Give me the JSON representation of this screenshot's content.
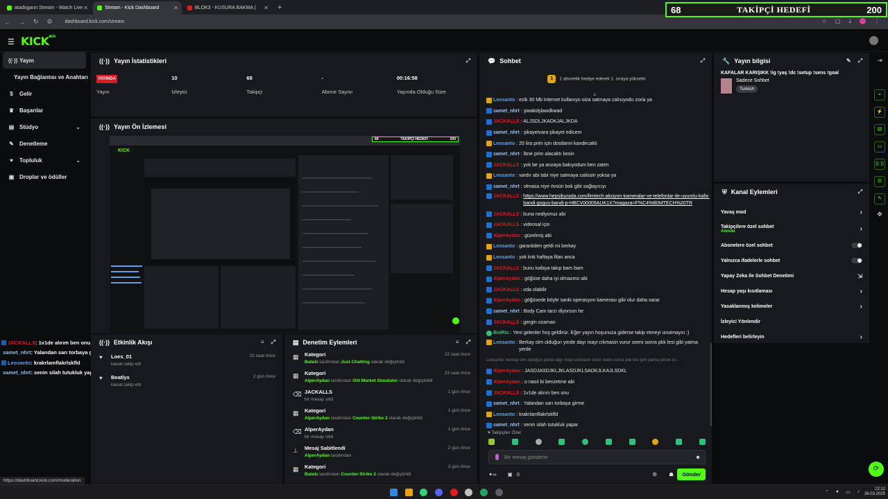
{
  "browser": {
    "tabs": [
      {
        "label": "atadogann Stream - Watch Live",
        "favicon_color": "#53fc18"
      },
      {
        "label": "Stream - Kick Dashboard",
        "favicon_color": "#53fc18"
      },
      {
        "label": "BLOK3 - KUSURA BAKMA (",
        "favicon_color": "#e01b24"
      }
    ],
    "new_tab": "+",
    "url": "dashboard.kick.com/stream",
    "status_url": "https://dashboard.kick.com/moderation"
  },
  "goal": {
    "current": "68",
    "label": "TAKİPÇİ HEDEFİ",
    "target": "200",
    "progress": 0.34
  },
  "app": {
    "logo": "KICK",
    "beta": "BETA"
  },
  "sidebar": {
    "items": [
      {
        "label": "Yayın",
        "icon": "broadcast-icon"
      },
      {
        "label": "Yayın Bağlantısı ve Anahtarı"
      },
      {
        "label": "Gelir",
        "icon": "dollar-icon"
      },
      {
        "label": "Başarılar",
        "icon": "trophy-icon"
      },
      {
        "label": "Stüdyo",
        "icon": "studio-icon"
      },
      {
        "label": "Denetleme",
        "icon": "wrench-icon"
      },
      {
        "label": "Topluluk",
        "icon": "community-icon"
      },
      {
        "label": "Droplar ve ödüller",
        "icon": "gift-icon"
      }
    ]
  },
  "left_overlay_chat": [
    {
      "user": "JACKALLS",
      "color": "#e01b24",
      "text": ": 1v1de alırım ben onu"
    },
    {
      "user": "samet_nhrt",
      "color": "#99c1f1",
      "text": ": Yalandan sarı torbaya girme"
    },
    {
      "user": "Leosanto",
      "color": "#62a0ea",
      "text": ": krakrlamflakrlskfld"
    },
    {
      "user": "samet_nhrt",
      "color": "#99c1f1",
      "text": ": senin silah tutukluk yapar"
    }
  ],
  "stats_panel": {
    "title": "Yayın İstatistikleri",
    "live_badge": "YAYINDA",
    "items": [
      {
        "value": "",
        "label": "Yayın"
      },
      {
        "value": "10",
        "label": "İzleyici"
      },
      {
        "value": "68",
        "label": "Takipçi"
      },
      {
        "value": "-",
        "label": "Abone Sayısı"
      },
      {
        "value": "00:16:58",
        "label": "Yayında Olduğu Süre"
      }
    ]
  },
  "preview_panel": {
    "title": "Yayın Ön İzlemesi",
    "mini_goal_current": "68",
    "mini_goal_label": "TAKİPÇİ HEDEFİ",
    "mini_goal_target": "200",
    "mini_logo": "KICK"
  },
  "activity_panel": {
    "title": "Etkinlik Akışı",
    "items": [
      {
        "name": "Loes_01",
        "sub": "kanalı takip etti",
        "time": "22 saat önce"
      },
      {
        "name": "Beatlyx",
        "sub": "kanalı takip etti",
        "time": "2 gün önce"
      }
    ]
  },
  "moderation_panel": {
    "title": "Denetim Eylemleri",
    "items": [
      {
        "title": "Kategori",
        "actor": "Batuiz",
        "mid": " tarafından ",
        "target": "Just Chatting",
        "end": " olarak değiştirildi",
        "time": "22 saat önce",
        "icon": "category-icon"
      },
      {
        "title": "Kategori",
        "actor": "AlperAydan",
        "mid": " tarafından ",
        "target": "Old Market Simulator",
        "end": " olarak değiştirildi",
        "time": "23 saat önce",
        "icon": "category-icon"
      },
      {
        "title": "JACKALLS",
        "actor": "",
        "mid": "bir mesajı sildi",
        "target": "",
        "end": "",
        "time": "1 gün önce",
        "icon": "trash-icon"
      },
      {
        "title": "Kategori",
        "actor": "AlperAydan",
        "mid": " tarafından ",
        "target": "Counter-Strike 2",
        "end": " olarak değiştirildi",
        "time": "1 gün önce",
        "icon": "category-icon"
      },
      {
        "title": "AlperAydan",
        "actor": "",
        "mid": "bir mesajı sildi",
        "target": "",
        "end": "",
        "time": "1 gün önce",
        "icon": "trash-icon"
      },
      {
        "title": "Mesaj Sabitlendi",
        "actor": "AlperAydan",
        "mid": " tarafından",
        "target": "",
        "end": "",
        "time": "2 gün önce",
        "icon": "pin-icon"
      },
      {
        "title": "Kategori",
        "actor": "Batuiz",
        "mid": " tarafından ",
        "target": "Counter-Strike 2",
        "end": " olarak değiştirildi",
        "time": "2 gün önce",
        "icon": "category-icon"
      }
    ]
  },
  "chat_panel": {
    "title": "Sohbet",
    "sub_gift": "1 abonelik hediye ederek 1. sıraya yükselin",
    "sub_gift_rank": "1",
    "messages": [
      {
        "user": "Leosanto",
        "color": "#62a0ea",
        "badge": "y",
        "text": "ezik 30 Mb internet kullanıyo oiza satmaya calısıyodu zoria ya"
      },
      {
        "user": "samet_nhrt",
        "color": "#99c1f1",
        "badge": "",
        "text": "şiwakdşlawdkwad"
      },
      {
        "user": "JACKALLS",
        "color": "#e01b24",
        "badge": "",
        "text": "ALJSDLJKADKJALJKDA"
      },
      {
        "user": "samet_nhrt",
        "color": "#99c1f1",
        "badge": "",
        "text": "şikayetvara şikayet edicem"
      },
      {
        "user": "Leosanto",
        "color": "#62a0ea",
        "badge": "y",
        "text": "20 lira prim için dostlarini kandircakti"
      },
      {
        "user": "samet_nhrt",
        "color": "#99c1f1",
        "badge": "",
        "text": "lbne prim alacaktı kesin"
      },
      {
        "user": "JACKALLS",
        "color": "#e01b24",
        "badge": "",
        "text": "yok be ya anzaya bakıyodum ben zaten"
      },
      {
        "user": "Leosanto",
        "color": "#62a0ea",
        "badge": "y",
        "text": "vardır abi tabi niye satmaya calissin yoksa ya"
      },
      {
        "user": "samet_nhrt",
        "color": "#99c1f1",
        "badge": "",
        "text": "olmasa niye övsün bok gibi sağlayıcıyı"
      },
      {
        "user": "JACKALLS",
        "color": "#e01b24",
        "badge": "",
        "link": "https://www.hepsiburada.com/fimtech-aksiyon-kameralar-ve-telefonlar-ile-uyumlu-kafa-bandi-gogus-bandi-p-HBCV00009AUK1X?magaza=F%C4%B0MTECH%20TR"
      },
      {
        "user": "JACKALLS",
        "color": "#e01b24",
        "badge": "",
        "text": "buna nediyonuz abi"
      },
      {
        "user": "JACKALLS",
        "color": "#e01b24",
        "badge": "",
        "text": "videosal için"
      },
      {
        "user": "AlperAydan",
        "color": "#e01b24",
        "badge": "",
        "text": "güzelmiş abi"
      },
      {
        "user": "Leosanto",
        "color": "#62a0ea",
        "badge": "y",
        "text": "garantiden geldi mi berkay"
      },
      {
        "user": "Leosanto",
        "color": "#62a0ea",
        "badge": "y",
        "text": "yok knk haftaya filan anca"
      },
      {
        "user": "JACKALLS",
        "color": "#e01b24",
        "badge": "",
        "text": "bunu kafaya takıp bam bam"
      },
      {
        "user": "AlperAydan",
        "color": "#e01b24",
        "badge": "",
        "text": "göğüse daha iyi olmazmo abi"
      },
      {
        "user": "JACKALLS",
        "color": "#e01b24",
        "badge": "",
        "text": "oda olabilir"
      },
      {
        "user": "AlperAydan",
        "color": "#e01b24",
        "badge": "",
        "text": "göğüsede böyle sanki operasyon kamerası gibi olur daha sarar"
      },
      {
        "user": "samet_nhrt",
        "color": "#99c1f1",
        "badge": "",
        "text": "Body Cam tarzı diyorsun he"
      },
      {
        "user": "JACKALLS",
        "color": "#e01b24",
        "badge": "",
        "text": "gergin ozaman"
      },
      {
        "user": "BotRix",
        "color": "#2ec27e",
        "badge": "gr",
        "text": "Yeni gelenler hoş geldiniz. Eğer yayın hoşunuza giderse takip etmeyi unutmayın :)"
      },
      {
        "user": "Leosanto",
        "color": "#62a0ea",
        "badge": "y",
        "text": "Berkay olm olduğun yerde dayı mayi cıkmasin vurur seeni sonra pkk lesi gibi yatma yerde",
        "wrap": true
      },
      {
        "user": "",
        "color": "#888",
        "badge": "",
        "text": "Leosanto: Berkay olm olduğun yerde dayı mayi cıkmasin vurur seeni sonra pkk lesi gibi yatma yerde isi...",
        "reply": true
      },
      {
        "user": "AlperAydan",
        "color": "#e01b24",
        "badge": "",
        "text": "JASDJASDJKLJKLASDJKLSADKJLKAJLSDKL"
      },
      {
        "user": "AlperAydan",
        "color": "#e01b24",
        "badge": "",
        "text": "o nasıl bi benzetme abi"
      },
      {
        "user": "JACKALLS",
        "color": "#e01b24",
        "badge": "",
        "text": "1v1de alırım ben onu"
      },
      {
        "user": "samet_nhrt",
        "color": "#99c1f1",
        "badge": "",
        "text": "Yalandan sarı torbaya girme"
      },
      {
        "user": "Leosanto",
        "color": "#62a0ea",
        "badge": "y",
        "text": "krakrlamflakrlskfld"
      },
      {
        "user": "samet_nhrt",
        "color": "#99c1f1",
        "badge": "",
        "text": "senin silah tutukluk yapar"
      }
    ],
    "followers_only": "Takipçiler Özel",
    "input_placeholder": "Bir mesaj gönderin",
    "footer_count_a": "0",
    "footer_count_b": "0",
    "send_label": "Gönder"
  },
  "info_panel": {
    "title": "Yayın bilgisi",
    "stream_title": "KAFALAR KARIŞIKK !ig !yaş !dc !setup !sens !goal",
    "category": "Sadece Sohbet",
    "language": "Turkish"
  },
  "actions_panel": {
    "title": "Kanal Eylemleri",
    "items": [
      {
        "label": "Yavaş mod",
        "control": "arrow"
      },
      {
        "label": "Takipçilere özel sohbet",
        "sublabel": "Anında",
        "control": "arrow"
      },
      {
        "label": "Abonelere özel sohbet",
        "control": "toggle"
      },
      {
        "label": "Yalnızca ifadelerle sohbet",
        "control": "toggle"
      },
      {
        "label": "Yapay Zeka ile Sohbet Denetimi",
        "control": "external"
      },
      {
        "label": "Hesap yaşı kısıtlaması",
        "control": "arrow"
      },
      {
        "label": "Yasaklanmış kelimeler",
        "control": "arrow"
      },
      {
        "label": "İzleyici Yönlendir",
        "control": "none"
      },
      {
        "label": "Hedefleri belirleyin",
        "control": "arrow"
      }
    ]
  },
  "taskbar": {
    "time": "22:12",
    "date": "26.03.2025"
  }
}
